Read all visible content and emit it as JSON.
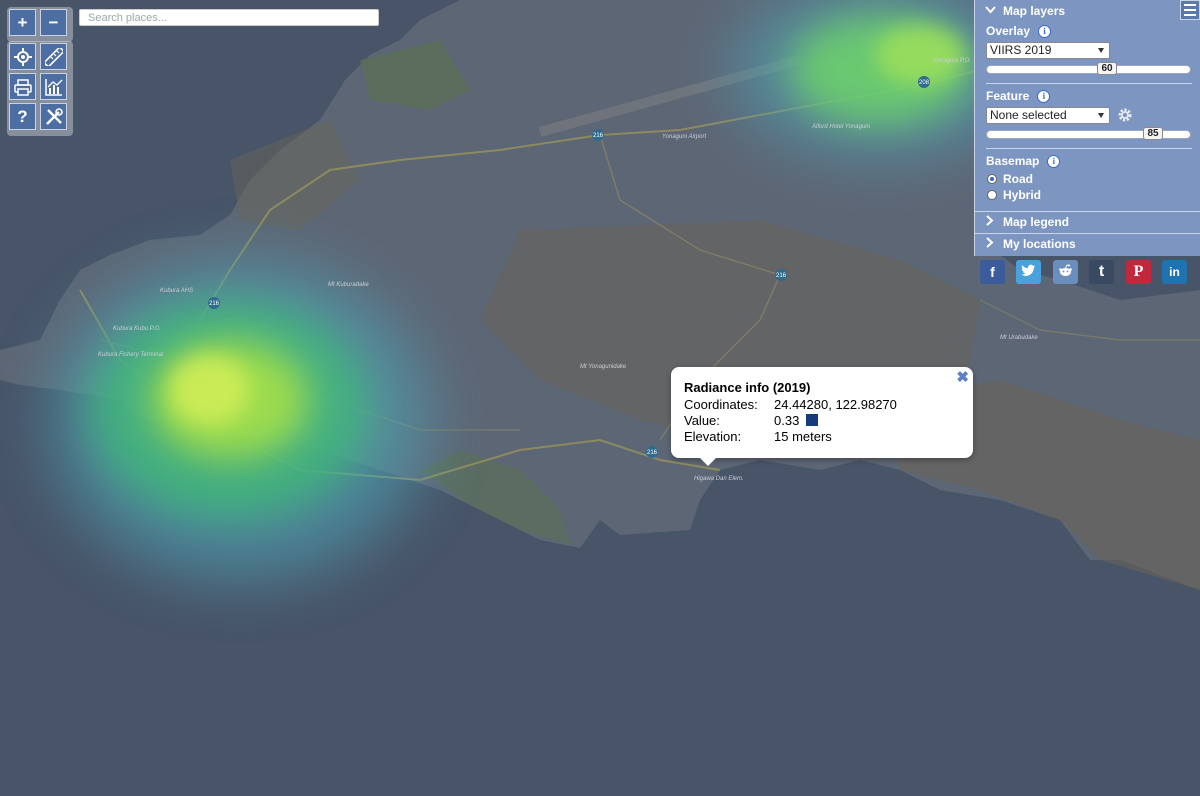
{
  "search": {
    "placeholder": "Search places..."
  },
  "controls": {
    "zoom_in": "+",
    "zoom_out": "−",
    "help": "?"
  },
  "panel": {
    "title": "Map layers",
    "overlay": {
      "label": "Overlay",
      "selected": "VIIRS 2019",
      "opacity": 60
    },
    "feature": {
      "label": "Feature",
      "selected": "None selected",
      "opacity": 85
    },
    "basemap": {
      "label": "Basemap",
      "options": [
        "Road",
        "Hybrid"
      ],
      "selected": "Road"
    },
    "legend_label": "Map legend",
    "locations_label": "My locations"
  },
  "share_icons": [
    {
      "name": "facebook-icon",
      "glyph": "f",
      "color": "#3b5b9a"
    },
    {
      "name": "twitter-icon",
      "glyph": "t",
      "color": "#49a2dc"
    },
    {
      "name": "reddit-icon",
      "glyph": "r",
      "color": "#6b8fbd"
    },
    {
      "name": "tumblr-icon",
      "glyph": "t",
      "color": "#3a4a62"
    },
    {
      "name": "pinterest-icon",
      "glyph": "P",
      "color": "#c2283b"
    },
    {
      "name": "linkedin-icon",
      "glyph": "in",
      "color": "#1e74b0"
    }
  ],
  "popup": {
    "title": "Radiance info (2019)",
    "coordinates_label": "Coordinates:",
    "coordinates": "24.44280, 122.98270",
    "value_label": "Value:",
    "value": "0.33",
    "value_color": "#173a7a",
    "elevation_label": "Elevation:",
    "elevation": "15 meters"
  },
  "map_labels": {
    "airport": "Yonaguni Airport",
    "fort": "Alford Hotel Yonaguni",
    "kubura_ahs": "Kubura AHS",
    "kubura_po": "Kubura Kubu P.O.",
    "kubura_fish": "Kubura Fishery Terminal",
    "mt_kubura": "Mt Kuburadake",
    "mt_yonaguni": "Mt Yonagunidake",
    "mt_urabu": "Mt Urabudake",
    "higawa": "Higawa Dan Elem.",
    "route_216": "216",
    "route_208": "208",
    "yonaguni_po": "Yonaguni P.O."
  }
}
